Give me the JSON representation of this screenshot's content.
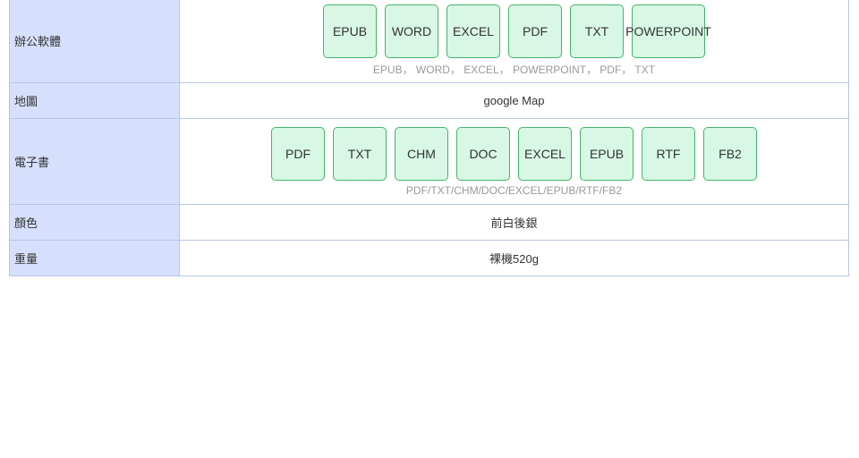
{
  "rows": {
    "office": {
      "label": "辦公軟體",
      "formats": [
        "EPUB",
        "WORD",
        "EXCEL",
        "PDF",
        "TXT",
        "POWERPOINT"
      ],
      "caption": "EPUB， WORD， EXCEL， POWERPOINT， PDF， TXT"
    },
    "map": {
      "label": "地圖",
      "value": "google Map"
    },
    "ebook": {
      "label": "電子書",
      "formats": [
        "PDF",
        "TXT",
        "CHM",
        "DOC",
        "EXCEL",
        "EPUB",
        "RTF",
        "FB2"
      ],
      "caption": "PDF/TXT/CHM/DOC/EXCEL/EPUB/RTF/FB2"
    },
    "color": {
      "label": "顏色",
      "value": "前白後銀"
    },
    "weight": {
      "label": "重量",
      "value": "裸機520g"
    }
  },
  "colors": {
    "label_bg": "#d6e0fd",
    "chip_bg": "#d8f7e5",
    "chip_border": "#43b56b",
    "table_border": "#b7c6e6"
  }
}
